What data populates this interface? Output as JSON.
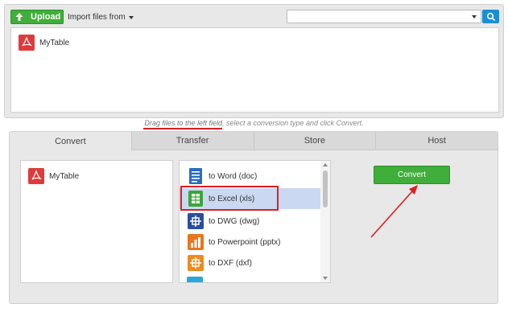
{
  "toolbar": {
    "upload_label": "Upload",
    "import_label": "Import files from",
    "search_placeholder": ""
  },
  "files": [
    {
      "name": "MyTable",
      "icon": "pdf-icon"
    }
  ],
  "hint": {
    "drag_text": "Drag files to the left field",
    "rest_text": ", select a conversion type and click Convert."
  },
  "tabs": [
    {
      "label": "Convert",
      "active": true
    },
    {
      "label": "Transfer",
      "active": false
    },
    {
      "label": "Store",
      "active": false
    },
    {
      "label": "Host",
      "active": false
    }
  ],
  "source_files": [
    {
      "name": "MyTable",
      "icon": "pdf-icon"
    }
  ],
  "conversions": [
    {
      "label": "to Word (doc)",
      "icon": "word-doc-icon",
      "selected": false
    },
    {
      "label": "to Excel (xls)",
      "icon": "excel-xls-icon",
      "selected": true
    },
    {
      "label": "to DWG (dwg)",
      "icon": "dwg-icon",
      "selected": false
    },
    {
      "label": "to Powerpoint (pptx)",
      "icon": "powerpoint-icon",
      "selected": false
    },
    {
      "label": "to DXF (dxf)",
      "icon": "dxf-icon",
      "selected": false
    }
  ],
  "convert_button": "Convert",
  "colors": {
    "green": "#3fae3a",
    "blue": "#1a8fd6",
    "highlight": "#e01e1e",
    "selected": "#cbd8f1"
  }
}
